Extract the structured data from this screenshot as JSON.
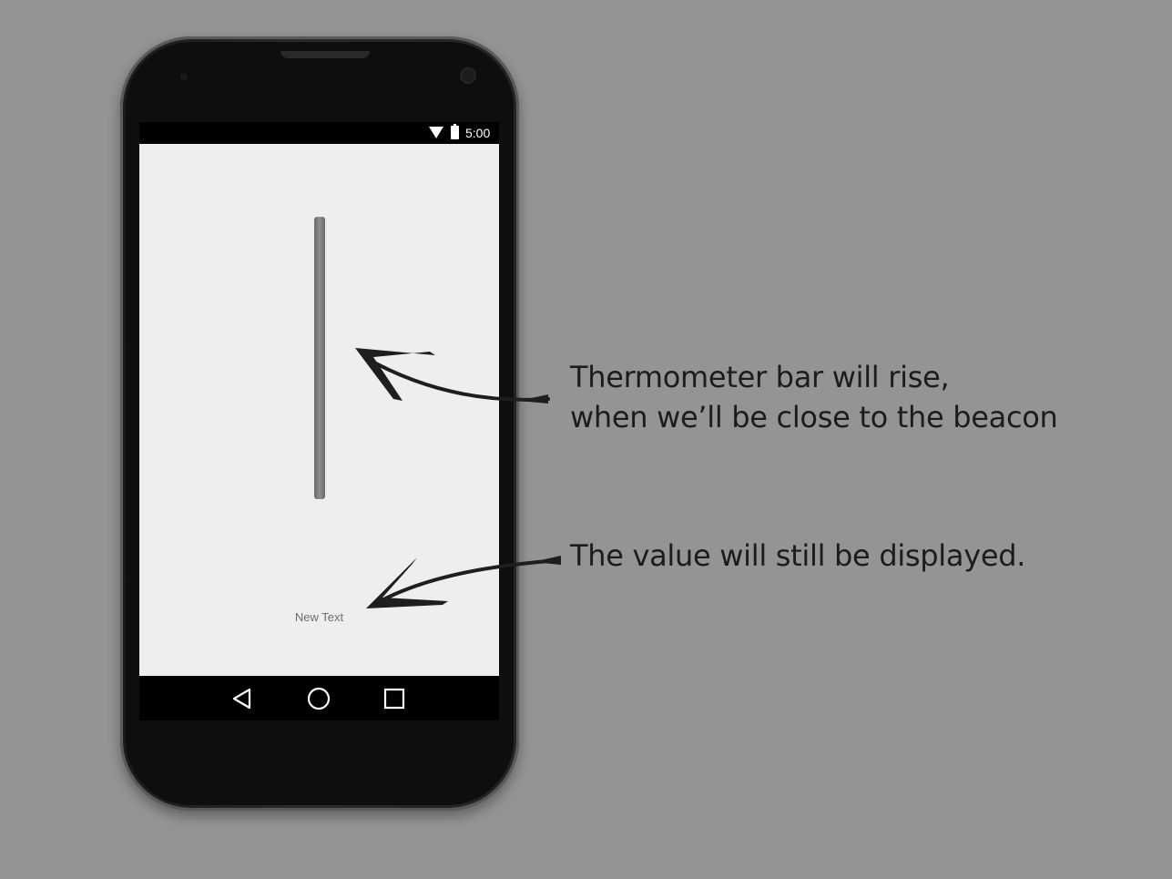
{
  "status_bar": {
    "time": "5:00",
    "icons": [
      "wifi-icon",
      "battery-icon"
    ]
  },
  "app": {
    "thermometer": {
      "level": 0
    },
    "value_text": "New Text"
  },
  "nav_bar": {
    "icons": [
      "back-icon",
      "home-icon",
      "recents-icon"
    ]
  },
  "annotations": {
    "thermometer_note": [
      "Thermometer bar will rise,",
      "when we’ll be close to the beacon"
    ],
    "value_note": "The value will still be displayed."
  },
  "colors": {
    "background": "#949494",
    "screen": "#eeeeee",
    "bar": "#7a7a7a",
    "text": "#1c1c1c"
  }
}
